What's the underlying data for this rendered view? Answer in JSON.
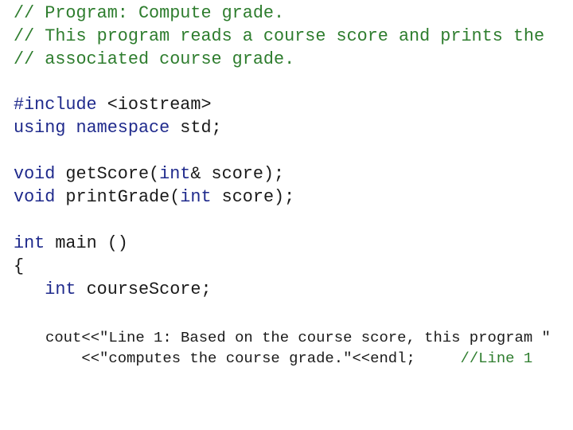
{
  "colors": {
    "comment": "#2e7d2e",
    "keyword": "#1f2a8c",
    "plain": "#1a1a1a",
    "background": "#ffffff"
  },
  "code": {
    "header_comments": [
      "// Program: Compute grade.",
      "// This program reads a course score and prints the",
      "// associated course grade."
    ],
    "include": {
      "directive": "#include",
      "header": " <iostream>"
    },
    "using": {
      "kw_using": "using",
      "kw_namespace": " namespace",
      "name": " std;"
    },
    "proto_get_score": {
      "kw_void": "void",
      "name": " getScore(",
      "kw_int": "int",
      "rest": "& score);"
    },
    "proto_print_grade": {
      "kw_void": "void",
      "name": " printGrade(",
      "kw_int": "int",
      "rest": " score);"
    },
    "main_decl": {
      "kw_int": "int",
      "rest": " main ()"
    },
    "open_brace": "{",
    "var_decl": {
      "indent": "   ",
      "kw_int": "int",
      "rest": " courseScore;"
    },
    "cout_line1": "   cout<<\"Line 1: Based on the course score, this program \"",
    "cout_line2": {
      "code": "       <<\"computes the course grade.\"<<endl;",
      "gap": "     ",
      "comment": "//Line 1"
    }
  }
}
